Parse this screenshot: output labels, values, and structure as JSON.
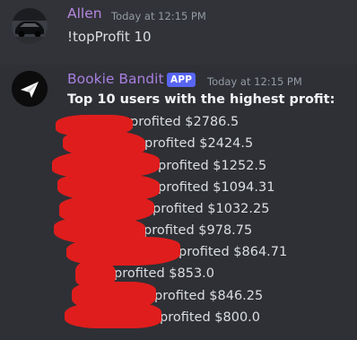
{
  "messages": [
    {
      "username": "Allen",
      "timestamp": "Today at 12:15 PM",
      "text": "!topProfit 10",
      "avatar_icon": "car-avatar-icon"
    },
    {
      "username": "Bookie Bandit",
      "badge": "APP",
      "timestamp": "Today at 12:15 PM",
      "heading": "Top 10 users with the highest profit:",
      "avatar_icon": "bookie-bandit-logo-icon",
      "lines": [
        "profited $2786.5",
        "profited $2424.5",
        "profited $1252.5",
        "profited $1094.31",
        "profited $1032.25",
        "profited $978.75",
        "profited $864.71",
        "profited $853.0",
        "profited $846.25",
        "profited $800.0"
      ]
    }
  ],
  "colors": {
    "background": "#313338",
    "allen_name": "#b587e0",
    "bot_name": "#a97fe0",
    "app_badge": "#5865f2",
    "redaction": "#e01d1d"
  }
}
